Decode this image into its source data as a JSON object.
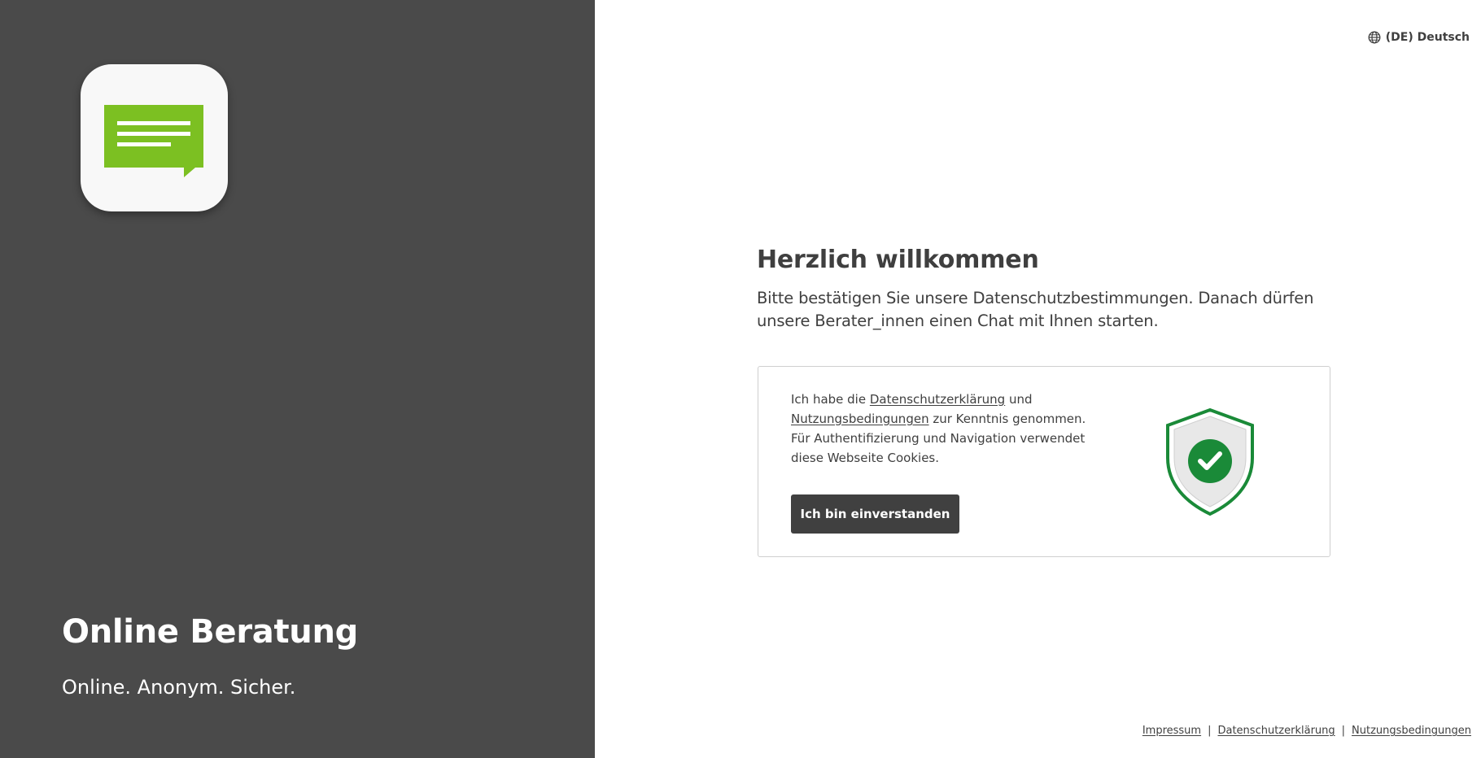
{
  "brand": {
    "title": "Online Beratung",
    "claim": "Online. Anonym. Sicher."
  },
  "language": {
    "label": "(DE) Deutsch",
    "icon": "globe-icon"
  },
  "welcome": {
    "title": "Herzlich willkommen",
    "text": "Bitte bestätigen Sie unsere Datenschutzbestimmungen. Danach dürfen unsere Berater_innen einen Chat mit Ihnen starten."
  },
  "consent": {
    "prefix": "Ich habe die",
    "privacy_link": "Datenschutzerklärung",
    "and": "und",
    "terms_link": "Nutzungsbedingungen",
    "suffix": "zur Kenntnis genommen. Für Authentifizierung und Navigation verwendet diese Webseite Cookies.",
    "button_label": "Ich bin einverstanden",
    "illustration": "shield-check-icon"
  },
  "footer": {
    "links": [
      "Impressum",
      "Datenschutzerklärung",
      "Nutzungsbedingungen"
    ],
    "separator": "|"
  },
  "colors": {
    "left_panel": "#4a4a4a",
    "logo_green": "#7cc022",
    "shield_green": "#1a8a38",
    "button": "#404040"
  }
}
